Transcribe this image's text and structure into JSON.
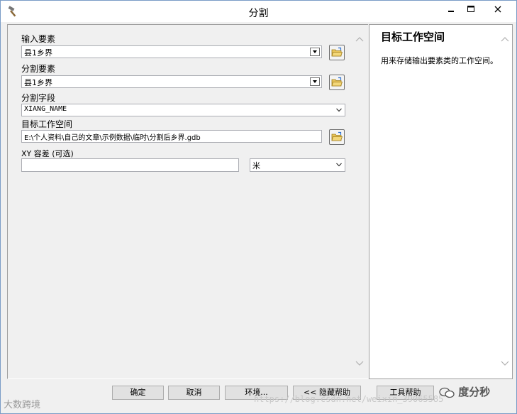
{
  "window": {
    "title": "分割"
  },
  "form": {
    "input_label": "输入要素",
    "input_value": "县1乡界",
    "split_label": "分割要素",
    "split_value": "县1乡界",
    "field_label": "分割字段",
    "field_value": "XIANG_NAME",
    "workspace_label": "目标工作空间",
    "workspace_value": "E:\\个人资料\\自己的文章\\示例数据\\临时\\分割后乡界.gdb",
    "xy_label": "XY 容差 (可选)",
    "xy_value": "",
    "unit_value": "米"
  },
  "help": {
    "title": "目标工作空间",
    "body": "用来存储输出要素类的工作空间。"
  },
  "buttons": {
    "ok": "确定",
    "cancel": "取消",
    "env": "环境...",
    "hide_help": "<< 隐藏帮助",
    "tool_help": "工具帮助"
  },
  "watermark": {
    "left": "大数跨境",
    "logo": "度分秒",
    "url": "https://blog.csdn.net/weixin_39065585"
  }
}
